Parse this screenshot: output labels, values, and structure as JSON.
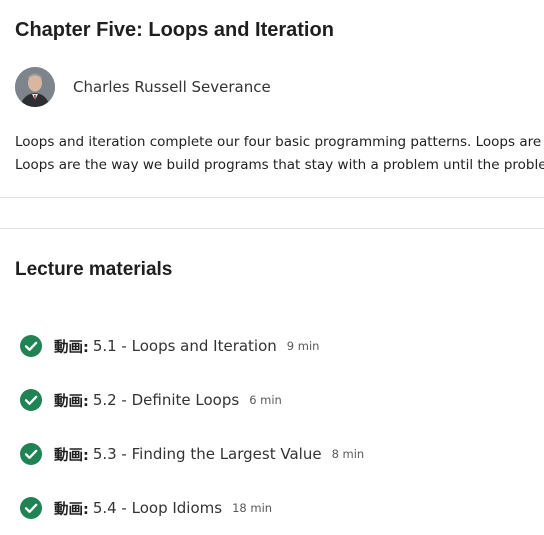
{
  "chapter": {
    "title": "Chapter Five: Loops and Iteration",
    "instructor_name": "Charles Russell Severance",
    "description_lines": [
      "Loops and iteration complete our four basic programming patterns. Loops are the",
      "Loops are the way we build programs that stay with a problem until the problem"
    ]
  },
  "lecture_materials": {
    "heading": "Lecture materials",
    "items": [
      {
        "type_label": "動画:",
        "title": "5.1 - Loops and Iteration",
        "duration": "9 min",
        "status": "completed"
      },
      {
        "type_label": "動画:",
        "title": "5.2 - Definite Loops",
        "duration": "6 min",
        "status": "completed"
      },
      {
        "type_label": "動画:",
        "title": "5.3 - Finding the Largest Value",
        "duration": "8 min",
        "status": "completed"
      },
      {
        "type_label": "動画:",
        "title": "5.4 - Loop Idioms",
        "duration": "18 min",
        "status": "completed"
      }
    ]
  },
  "colors": {
    "check_green": "#1f8354",
    "divider": "#e1e1e1",
    "text": "#1f1f1f"
  },
  "icons": {
    "completed": "check-circle-icon"
  }
}
